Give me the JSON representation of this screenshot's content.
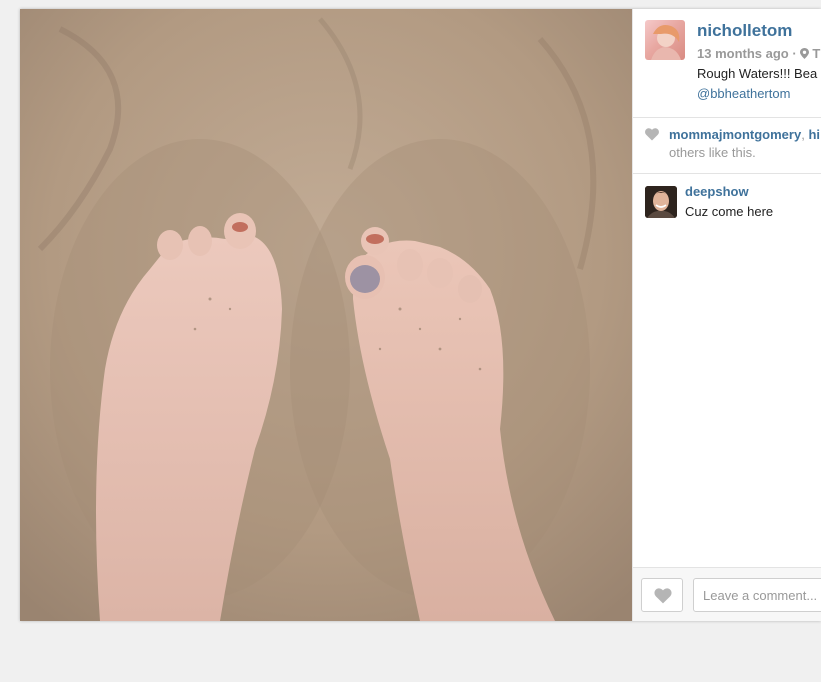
{
  "post": {
    "username": "nicholletom",
    "time_ago": "13 months ago",
    "meta_separator": "·",
    "location": "Th",
    "caption": "Rough Waters!!! Bea",
    "mention": "@bbheathertom",
    "photo_icon": "sand-feet-photo"
  },
  "likes": {
    "first_liker": "mommajmontgomery",
    "separator": ",",
    "second_liker": "hi",
    "tail": "others like this."
  },
  "comments": [
    {
      "username": "deepshow",
      "text": "Cuz come here"
    }
  ],
  "footer": {
    "comment_placeholder": "Leave a comment..."
  },
  "colors": {
    "link": "#3f729b",
    "muted": "#999999",
    "sand": "#b49e88"
  }
}
